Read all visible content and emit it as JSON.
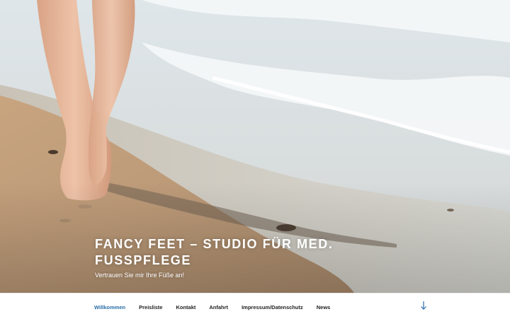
{
  "site": {
    "title": "FANCY FEET – STUDIO FÜR MED. FUSSPFLEGE",
    "description": "Vertrauen Sie mir Ihre Füße an!"
  },
  "nav": {
    "items": [
      {
        "label": "Willkommen",
        "active": true
      },
      {
        "label": "Preisliste",
        "active": false
      },
      {
        "label": "Kontakt",
        "active": false
      },
      {
        "label": "Anfahrt",
        "active": false
      },
      {
        "label": "Impressum/Datenschutz",
        "active": false
      },
      {
        "label": "News",
        "active": false
      }
    ],
    "scroll_icon": "arrow-down-icon"
  },
  "colors": {
    "accent": "#2b6ea8",
    "menu_text": "#222222",
    "title_text": "#ffffff"
  }
}
